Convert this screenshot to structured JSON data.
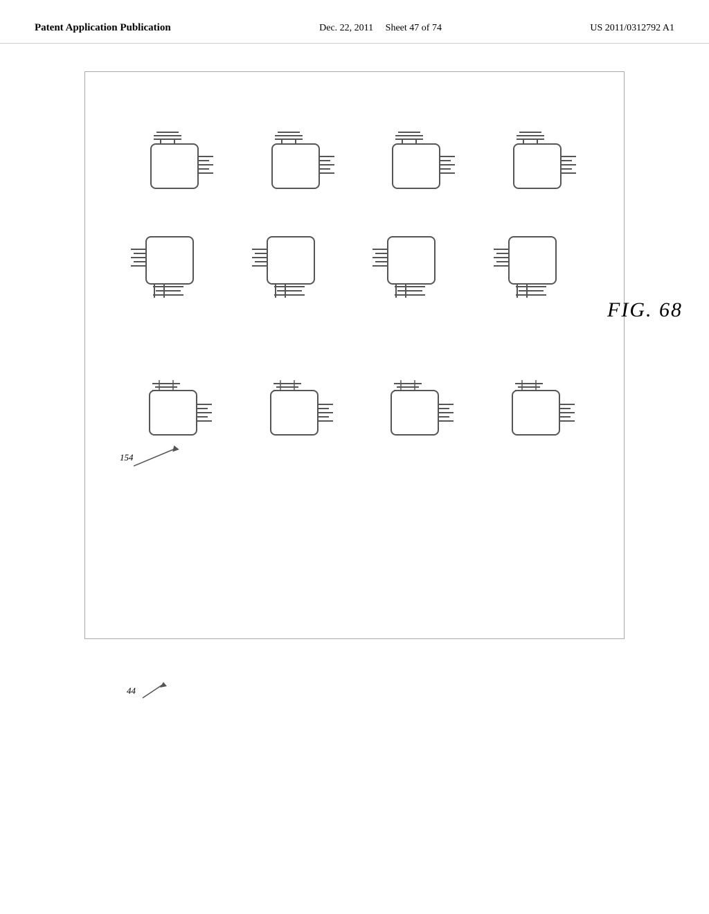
{
  "header": {
    "left": "Patent Application Publication",
    "center_date": "Dec. 22, 2011",
    "center_sheet": "Sheet 47 of 74",
    "right": "US 2011/0312792 A1"
  },
  "figure": {
    "label": "FIG. 68",
    "label_number": "154",
    "bottom_label": "44",
    "rows": [
      {
        "id": "row1",
        "type": "top-right",
        "count": 4
      },
      {
        "id": "row2",
        "type": "left-bottom",
        "count": 4
      },
      {
        "id": "row3",
        "type": "top-right-v2",
        "count": 4
      }
    ]
  }
}
